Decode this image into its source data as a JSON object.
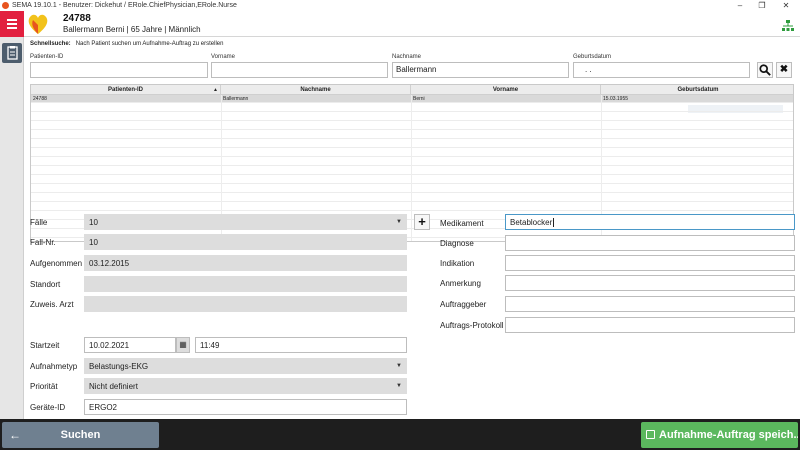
{
  "window": {
    "title": "SEMA 19.10.1 - Benutzer: Dickehut / ERole.ChiefPhysician,ERole.Nurse"
  },
  "header": {
    "patient_id": "24788",
    "patient_info": "Ballermann Berni | 65 Jahre | Männlich"
  },
  "search": {
    "quick_label": "Schnellsuche:",
    "quick_hint": "Nach Patient suchen um Aufnahme-Auftrag zu erstellen",
    "fields": [
      {
        "label": "Patienten-ID",
        "value": ""
      },
      {
        "label": "Vorname",
        "value": ""
      },
      {
        "label": "Nachname",
        "value": "Ballermann"
      },
      {
        "label": "Geburtsdatum",
        "value": ". ."
      }
    ],
    "search_icon": "search-icon",
    "clear_icon": "close-icon"
  },
  "table": {
    "columns": [
      "Patienten-ID",
      "Nachname",
      "Vorname",
      "Geburtsdatum"
    ],
    "sort_indicator": "▲",
    "rows": [
      [
        "24788",
        "Ballermann",
        "Berni",
        "15.03.1955"
      ]
    ]
  },
  "form": {
    "faelle_label": "Fälle",
    "faelle_value": "10",
    "fallnr_label": "Fall-Nr.",
    "fallnr_value": "10",
    "aufgenommen_label": "Aufgenommen",
    "aufgenommen_value": "03.12.2015",
    "standort_label": "Standort",
    "standort_value": "",
    "zuweis_label": "Zuweis. Arzt",
    "zuweis_value": "",
    "startzeit_label": "Startzeit",
    "startzeit_date": "10.02.2021",
    "startzeit_time": "11:49",
    "aufnahmetyp_label": "Aufnahmetyp",
    "aufnahmetyp_value": "Belastungs-EKG",
    "prioritaet_label": "Priorität",
    "prioritaet_value": "Nicht definiert",
    "geraete_label": "Geräte-ID",
    "geraete_value": "ERGO2",
    "add_label": "+"
  },
  "right_form": {
    "medikament_label": "Medikament",
    "medikament_value": "Betablocker",
    "diagnose_label": "Diagnose",
    "indikation_label": "Indikation",
    "anmerkung_label": "Anmerkung",
    "auftraggeber_label": "Auftraggeber",
    "protokoll_label": "Auftrags-Protokoll"
  },
  "footer": {
    "search_label": "Suchen",
    "save_label": "Aufnahme-Auftrag speich..."
  },
  "colors": {
    "menu_red": "#e2203f",
    "save_green": "#5bb85e",
    "search_grey": "#6f8090",
    "footer_bg": "#1e1e1e"
  }
}
